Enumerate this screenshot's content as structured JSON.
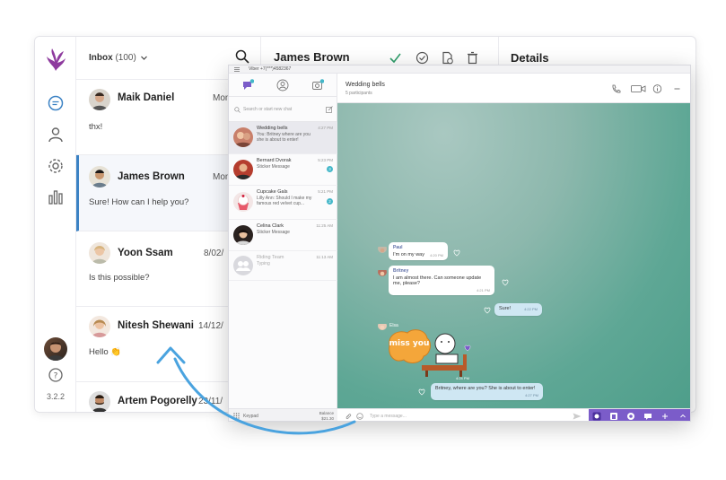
{
  "helpdesk": {
    "version": "3.2.2",
    "inbox": {
      "title": "Inbox",
      "count": "(100)"
    },
    "conversations": [
      {
        "name": "Maik Daniel",
        "time": "Mon",
        "message": "thx!"
      },
      {
        "name": "James Brown",
        "time": "Mon",
        "message": "Sure! How can I help you?"
      },
      {
        "name": "Yoon Ssam",
        "time": "8/02/",
        "message": "Is this possible?"
      },
      {
        "name": "Nitesh Shewani",
        "time": "14/12/",
        "message": "Hello 👏"
      },
      {
        "name": "Artem Pogorelly",
        "time": "23/11/",
        "message": ""
      }
    ],
    "ticket": {
      "name": "James Brown"
    },
    "details": {
      "title": "Details"
    }
  },
  "viber": {
    "window_title": "Viber +7(***)4582367",
    "search_placeholder": "Search or start new chat",
    "chats": [
      {
        "name": "Wedding bells",
        "message": "You: Britney where are you she is about to enter!",
        "time": "4:27 PM",
        "badge": ""
      },
      {
        "name": "Bernard Dvorak",
        "message": "Sticker Message",
        "time": "5:23 PM",
        "badge": "3"
      },
      {
        "name": "Cupcake Gals",
        "message": "Lilly Ann: Should I make my famous red velvet cup...",
        "time": "5:21 PM",
        "badge": "2"
      },
      {
        "name": "Celina Clark",
        "message": "Sticker Message",
        "time": "11:25 AM",
        "badge": ""
      },
      {
        "name": "Riding Team",
        "message": "Typing",
        "time": "11:13 AM",
        "badge": ""
      }
    ],
    "keypad_label": "Keypad",
    "balance_label": "Balance",
    "balance_value": "$21.30",
    "chat": {
      "title": "Wedding bells",
      "subtitle": "5 participants",
      "messages": [
        {
          "sender": "Paul",
          "text": "I'm on my way",
          "time": "4:20 PM"
        },
        {
          "sender": "Britney",
          "text": "I am almost there. Can someone update me, please?",
          "time": "4:21 PM"
        },
        {
          "sender": "",
          "text": "Sure!",
          "time": "4:22 PM"
        },
        {
          "sender": "Elsa",
          "text": "",
          "time": "4:24 PM"
        },
        {
          "sender": "",
          "text": "Britney, where are you? She is about to enter!",
          "time": "4:27 PM"
        }
      ],
      "sticker_text": "miss you",
      "input_placeholder": "Type a message..."
    }
  },
  "colors": {
    "accent_blue": "#3b82c4",
    "viber_purple": "#7b5cc9",
    "chat_green": "#5ea795",
    "arrow_blue": "#4aa3df"
  }
}
